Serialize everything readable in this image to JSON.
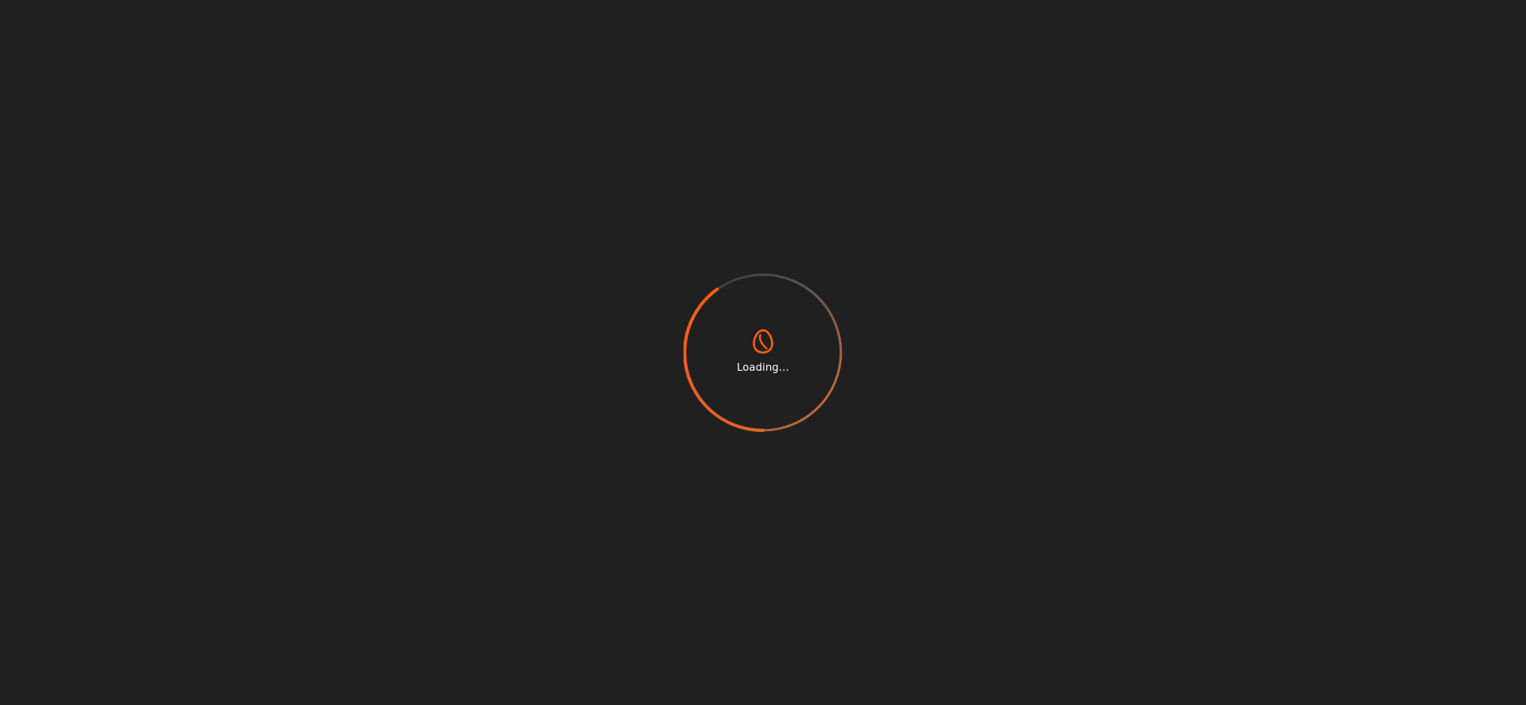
{
  "loader": {
    "text": "Loading...",
    "icon": "egg-icon",
    "accent_color": "#ff5f0f",
    "track_color": "#3a3a3a",
    "background_color": "#202020"
  }
}
